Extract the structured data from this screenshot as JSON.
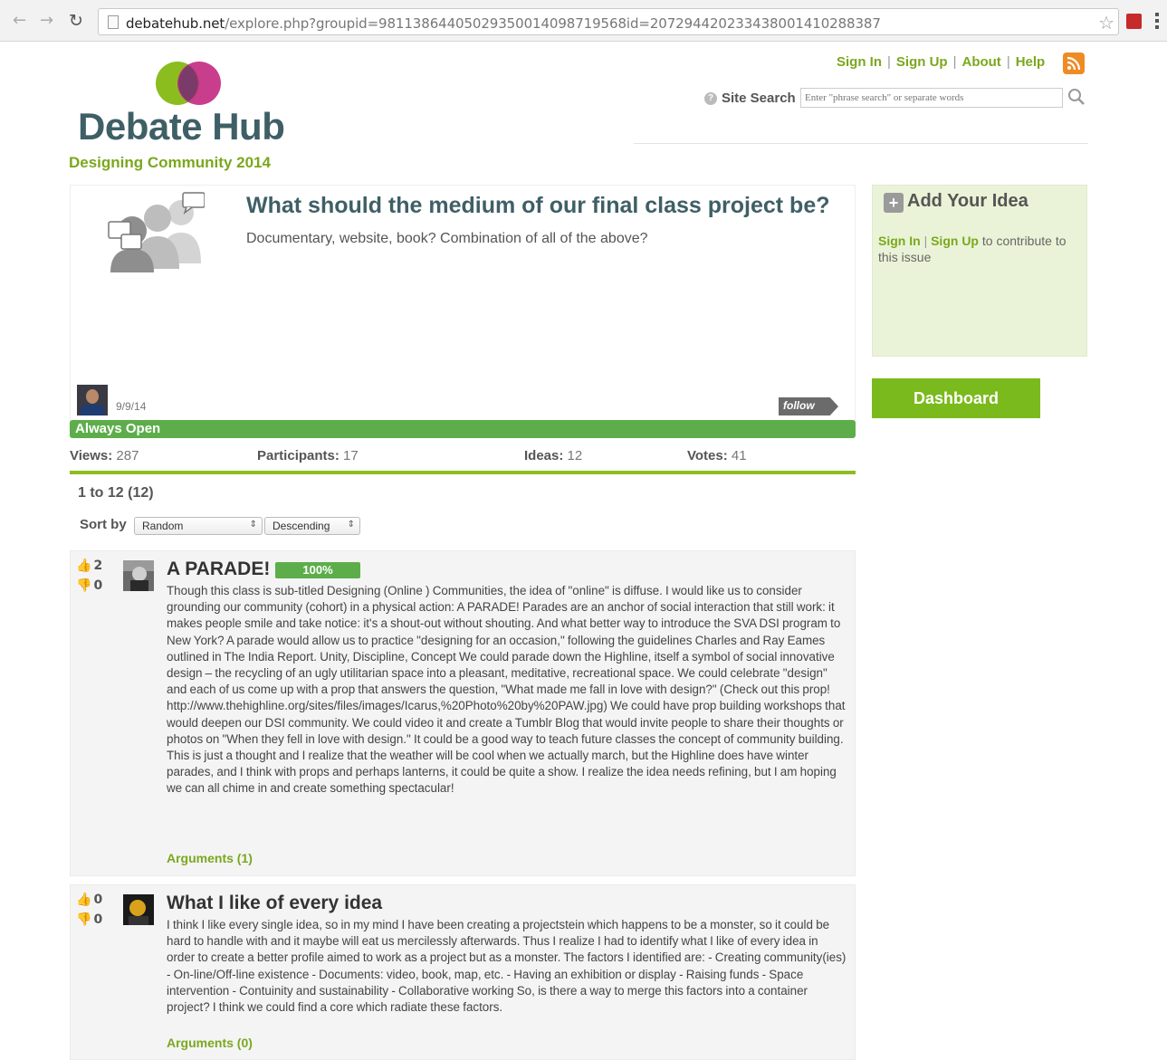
{
  "browser": {
    "url_host": "debatehub.net",
    "url_path": "/explore.php?groupid=98113864405029350014098719568id=207294420233438001410288387"
  },
  "header": {
    "site_name": "Debate Hub",
    "group_name": "Designing Community 2014",
    "links": {
      "sign_in": "Sign In",
      "sign_up": "Sign Up",
      "about": "About",
      "help": "Help"
    },
    "search": {
      "help_glyph": "?",
      "label": "Site Search",
      "placeholder": "Enter \"phrase search\" or separate words"
    }
  },
  "issue": {
    "title": "What should the medium of our final class project be?",
    "description": "Documentary, website, book? Combination of all of the above?",
    "date": "9/9/14",
    "follow_label": "follow",
    "status": "Always Open",
    "stats": {
      "views_label": "Views:",
      "views": "287",
      "participants_label": "Participants:",
      "participants": "17",
      "ideas_label": "Ideas:",
      "ideas": "12",
      "votes_label": "Votes:",
      "votes": "41"
    }
  },
  "list": {
    "range": "1 to 12 (12)",
    "sort_label": "Sort by",
    "sort_field": "Random",
    "sort_order": "Descending"
  },
  "ideas": [
    {
      "title": "A PARADE!",
      "percent": "100%",
      "up_votes": "2",
      "down_votes": "0",
      "body": "Though this class is sub-titled Designing (Online ) Communities, the idea of \"online\" is diffuse. I would like us to consider grounding our community (cohort) in a physical action: A PARADE! Parades are an anchor of social interaction that still work: it makes people smile and take notice: it's a shout-out without shouting. And what better way to introduce the SVA DSI program to New York? A parade would allow us to practice \"designing for an occasion,\" following the guidelines Charles and Ray Eames outlined in The India Report. Unity, Discipline, Concept We could parade down the Highline, itself a symbol of social innovative design – the recycling of an ugly utilitarian space into a pleasant, meditative, recreational space. We could celebrate \"design\" and each of us come up with a prop that answers the question, \"What made me fall in love with design?\" (Check out this prop! http://www.thehighline.org/sites/files/images/Icarus,%20Photo%20by%20PAW.jpg) We could have prop building workshops that would deepen our DSI community. We could video it and create a Tumblr Blog that would invite people to share their thoughts or photos on \"When they fell in love with design.\" It could be a good way to teach future classes the concept of community building. This is just a thought and I realize that the weather will be cool when we actually march, but the Highline does have winter parades, and I think with props and perhaps lanterns, it could be quite a show. I realize the idea needs refining, but I am hoping we can all chime in and create something spectacular!",
      "arguments": "Arguments (1)"
    },
    {
      "title": "What I like of every idea",
      "up_votes": "0",
      "down_votes": "0",
      "body": "I think I like every single idea, so in my mind I have been creating a projectstein which happens to be a monster, so it could be hard to handle with and it maybe will eat us mercilessly afterwards. Thus I realize I had to identify what I like of every idea in order to create a better profile aimed to work as a project but as a monster. The factors I identified are: - Creating community(ies) - On-line/Off-line existence - Documents: video, book, map, etc. - Having an exhibition or display - Raising funds - Space intervention - Contuinity and sustainability - Collaborative working So, is there a way to merge this factors into a container project? I think we could find a core which radiate these factors.",
      "arguments": "Arguments (0)"
    }
  ],
  "sidebar": {
    "add_idea_title": "Add Your Idea",
    "sign_in": "Sign In",
    "sign_up": "Sign Up",
    "contribute_text": "to contribute to this issue",
    "dashboard": "Dashboard"
  },
  "colors": {
    "brand_green": "#7aa81d",
    "status_green": "#5dae4b",
    "title_slate": "#3f5f66",
    "sidebar_bg": "#eaf3d7"
  }
}
